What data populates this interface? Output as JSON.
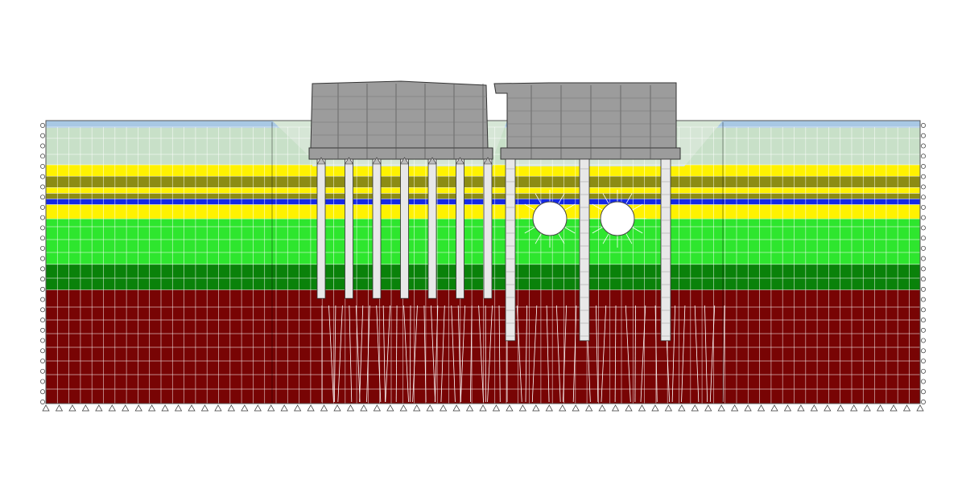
{
  "colors": {
    "background": "#ffffff",
    "fill_top": "#c8e0c8",
    "sky_strip": "#a8c8e4",
    "sand_yellow": "#fff200",
    "clay_olive": "#8c8c14",
    "water_blue": "#1428e6",
    "silt_light_green": "#2ee62e",
    "clay_dark_green": "#0a820a",
    "bedrock_red": "#780404",
    "structure_gray": "#9c9c9c",
    "pile_fill": "#e8e8e8",
    "tunnel_fill": "#ffffff",
    "mesh_line": "#ffffff",
    "outline": "#000000"
  },
  "layers": [
    {
      "name": "fill",
      "depth_top": 0.0,
      "depth_bottom": 1.5,
      "color_key": "fill_top"
    },
    {
      "name": "sand",
      "depth_top": 1.5,
      "depth_bottom": 1.9,
      "color_key": "sand_yellow"
    },
    {
      "name": "clay",
      "depth_top": 1.9,
      "depth_bottom": 2.3,
      "color_key": "clay_olive"
    },
    {
      "name": "sand",
      "depth_top": 2.3,
      "depth_bottom": 2.5,
      "color_key": "sand_yellow"
    },
    {
      "name": "clay",
      "depth_top": 2.5,
      "depth_bottom": 2.7,
      "color_key": "clay_olive"
    },
    {
      "name": "water",
      "depth_top": 2.7,
      "depth_bottom": 2.9,
      "color_key": "water_blue"
    },
    {
      "name": "sand",
      "depth_top": 2.9,
      "depth_bottom": 3.4,
      "color_key": "sand_yellow"
    },
    {
      "name": "silt",
      "depth_top": 3.4,
      "depth_bottom": 5.0,
      "color_key": "silt_light_green"
    },
    {
      "name": "clay",
      "depth_top": 5.0,
      "depth_bottom": 5.9,
      "color_key": "clay_dark_green"
    },
    {
      "name": "bedrock",
      "depth_top": 5.9,
      "depth_bottom": 9.9,
      "color_key": "bedrock_red"
    }
  ],
  "left_building": {
    "pile_count": 7,
    "pile_tip_depth": 6.2
  },
  "right_building": {
    "pile_count": 3,
    "pile_tip_depths": [
      8.0,
      8.0,
      8.0
    ]
  },
  "tunnels": [
    {
      "name": "tunnel-left"
    },
    {
      "name": "tunnel-right"
    }
  ],
  "supports": {
    "left_rollers": 28,
    "right_rollers": 28,
    "base_pins": 67
  }
}
